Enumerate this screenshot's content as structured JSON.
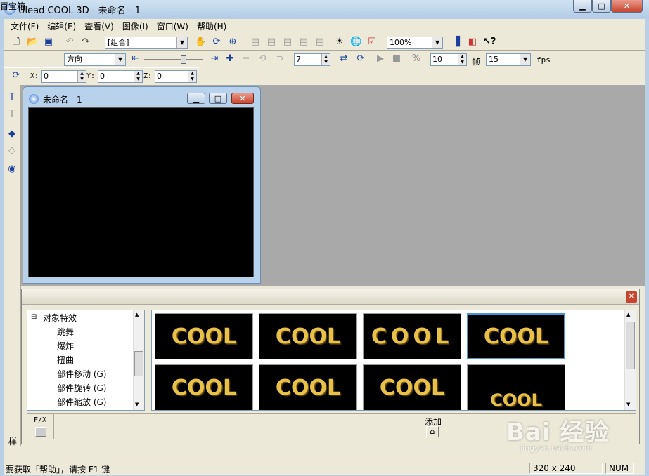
{
  "window": {
    "title": "Ulead COOL 3D - 未命名 - 1",
    "minimize": "▁",
    "maximize": "□",
    "close": "✕"
  },
  "menu": [
    "文件(F)",
    "编辑(E)",
    "查看(V)",
    "图像(I)",
    "窗口(W)",
    "帮助(H)"
  ],
  "toolbar1": {
    "object_combo": "[组合]",
    "zoom_combo": "100%"
  },
  "toolbar2": {
    "direction_combo": "方向",
    "frame_value": "7",
    "frames_total": "10",
    "frame_label": "帧",
    "fps_value": "15",
    "fps_label": "fps"
  },
  "toolbar3": {
    "x_label": "X:",
    "x_value": "0",
    "y_label": "Y:",
    "y_value": "0",
    "z_label": "Z:",
    "z_value": "0"
  },
  "document": {
    "title": "未命名 - 1"
  },
  "gallery": {
    "title": "百宝箱",
    "tree_root": "对象特效",
    "tree_items": [
      "跳舞",
      "爆炸",
      "扭曲",
      "部件移动 (G)",
      "部件旋转 (G)",
      "部件缩放 (G)"
    ],
    "thumbs": [
      "COOL",
      "COOL",
      "COOL",
      "COOL",
      "COOL",
      "COOL",
      "COOL",
      "COOL"
    ],
    "fx_label": "F/X",
    "add_label": "添加",
    "side_tab": "样"
  },
  "status": {
    "help_text": "要获取「帮助」，请按 F1 键",
    "size": "320 x 240",
    "num": "NUM"
  },
  "watermark": {
    "text": "Bai 经验",
    "url": "jingyan.baidu.com"
  }
}
